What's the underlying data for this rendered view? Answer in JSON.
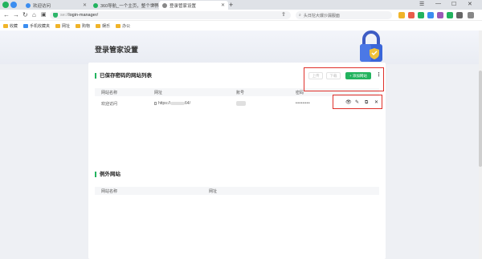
{
  "browser": {
    "tabs": [
      {
        "label": "欢迎访问",
        "favicon_color": "#3b8df0"
      },
      {
        "label": "360导航_一个主页，整个世界",
        "favicon_color": "#22b35e"
      },
      {
        "label": "登录管家设置",
        "favicon_color": "#555555"
      }
    ],
    "url_protocol": "se://",
    "url_path": "login-manager/",
    "search_placeholder": "头日挖大爆沙漏服面",
    "bookmarks": [
      {
        "label": "收藏",
        "color": "#f0b429"
      },
      {
        "label": "手机收藏夹",
        "color": "#3b8df0"
      },
      {
        "label": "网址",
        "color": "#f0b429"
      },
      {
        "label": "购物",
        "color": "#f0b429"
      },
      {
        "label": "娱乐",
        "color": "#f0b429"
      },
      {
        "label": "办公",
        "color": "#f0b429"
      }
    ]
  },
  "page": {
    "title": "登录管家设置"
  },
  "saved_section": {
    "title": "已保存密码的网站列表",
    "import_label": "上传",
    "export_label": "下载",
    "add_label": "+ 添加网站",
    "more_label": "⋮",
    "columns": [
      "网站名称",
      "网址",
      "账号",
      "密码"
    ],
    "rows": [
      {
        "name": "欢迎访问",
        "url_prefix": "https://",
        "url_suffix": "64/",
        "password": "••••••••"
      }
    ]
  },
  "except_section": {
    "title": "例外网站",
    "columns": [
      "网站名称",
      "网址"
    ]
  },
  "colors": {
    "accent": "#22b35e",
    "highlight": "#e0302a"
  }
}
